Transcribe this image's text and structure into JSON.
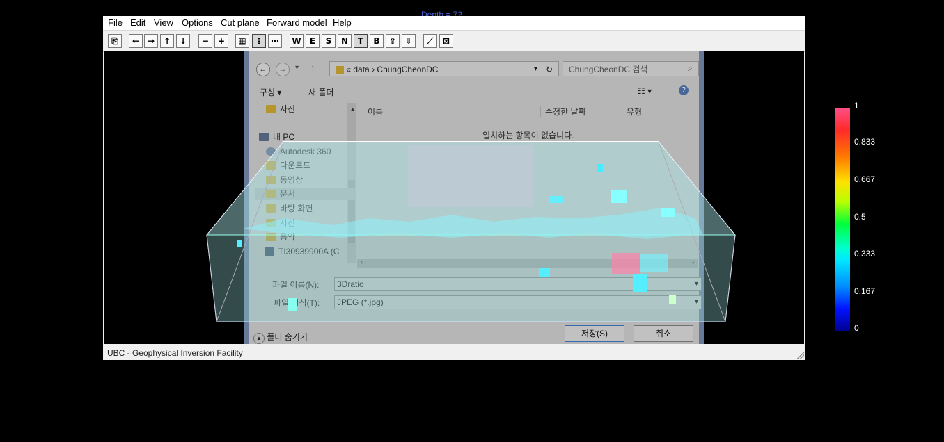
{
  "overlay_title": "Depth = 72",
  "menu": [
    "File",
    "Edit",
    "View",
    "Options",
    "Cut plane",
    "Forward model",
    "Help"
  ],
  "toolbar": {
    "letters": [
      "W",
      "E",
      "S",
      "N",
      "T",
      "B"
    ]
  },
  "status": "UBC - Geophysical Inversion Facility",
  "dialog": {
    "address_data": "data",
    "address_folder": "ChungCheonDC",
    "address_prefix": "«",
    "search_placeholder": "ChungCheonDC 검색",
    "organize": "구성 ▾",
    "new_folder": "새 폴더",
    "tree": [
      "사진",
      "내 PC",
      "Autodesk 360",
      "다운로드",
      "동영상",
      "문서",
      "바탕 화면",
      "사진",
      "음악",
      "TI30939900A (C"
    ],
    "col_name": "이름",
    "col_date": "수정한 날짜",
    "col_type": "유형",
    "empty_msg": "일치하는 항목이 없습니다.",
    "filename_label": "파일 이름(N):",
    "filename_value": "3Dratio",
    "filetype_label": "파일 형식(T):",
    "filetype_value": "JPEG (*.jpg)",
    "hide_folders": "폴더 숨기기",
    "save": "저장(S)",
    "cancel": "취소"
  },
  "colorbar": {
    "ticks": [
      "1",
      "0.833",
      "0.667",
      "0.5",
      "0.333",
      "0.167",
      "0"
    ]
  }
}
